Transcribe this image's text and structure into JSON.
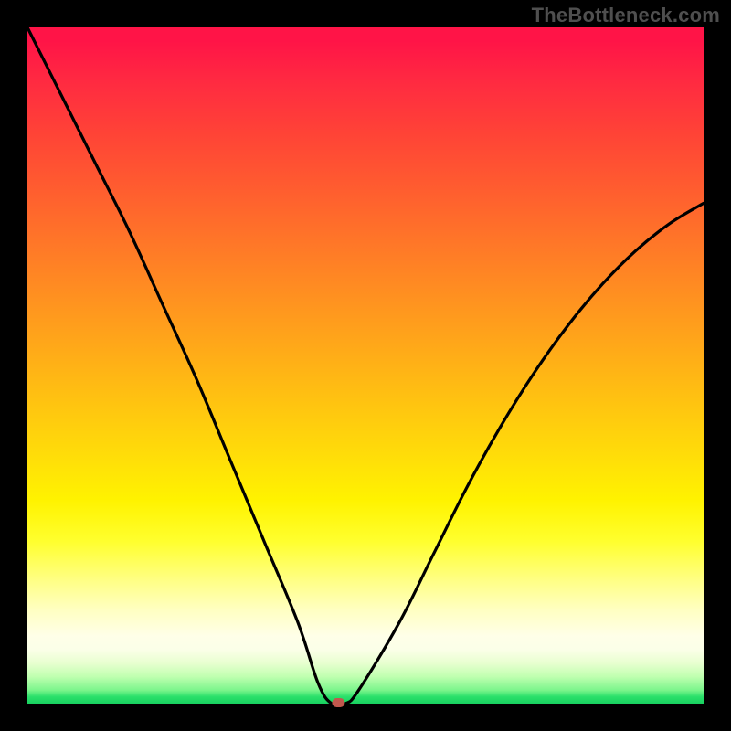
{
  "watermark": "TheBottleneck.com",
  "chart_data": {
    "type": "line",
    "title": "",
    "xlabel": "",
    "ylabel": "",
    "xlim": [
      0,
      100
    ],
    "ylim": [
      0,
      100
    ],
    "grid": false,
    "legend": false,
    "gradient_meaning": "vertical gradient from red (high bottleneck) at top to green (no bottleneck) at bottom",
    "series": [
      {
        "name": "bottleneck-curve",
        "x": [
          0,
          5,
          10,
          15,
          20,
          25,
          30,
          35,
          40,
          43,
          45,
          47,
          49,
          55,
          60,
          65,
          70,
          75,
          80,
          85,
          90,
          95,
          100
        ],
        "values": [
          100,
          90,
          80,
          70,
          59,
          48,
          36,
          24,
          12,
          3,
          0,
          0,
          2,
          12,
          22,
          32,
          41,
          49,
          56,
          62,
          67,
          71,
          74
        ]
      }
    ],
    "marker": {
      "x": 46,
      "y": 0,
      "color": "#c1584e",
      "shape": "rounded-rect"
    }
  }
}
